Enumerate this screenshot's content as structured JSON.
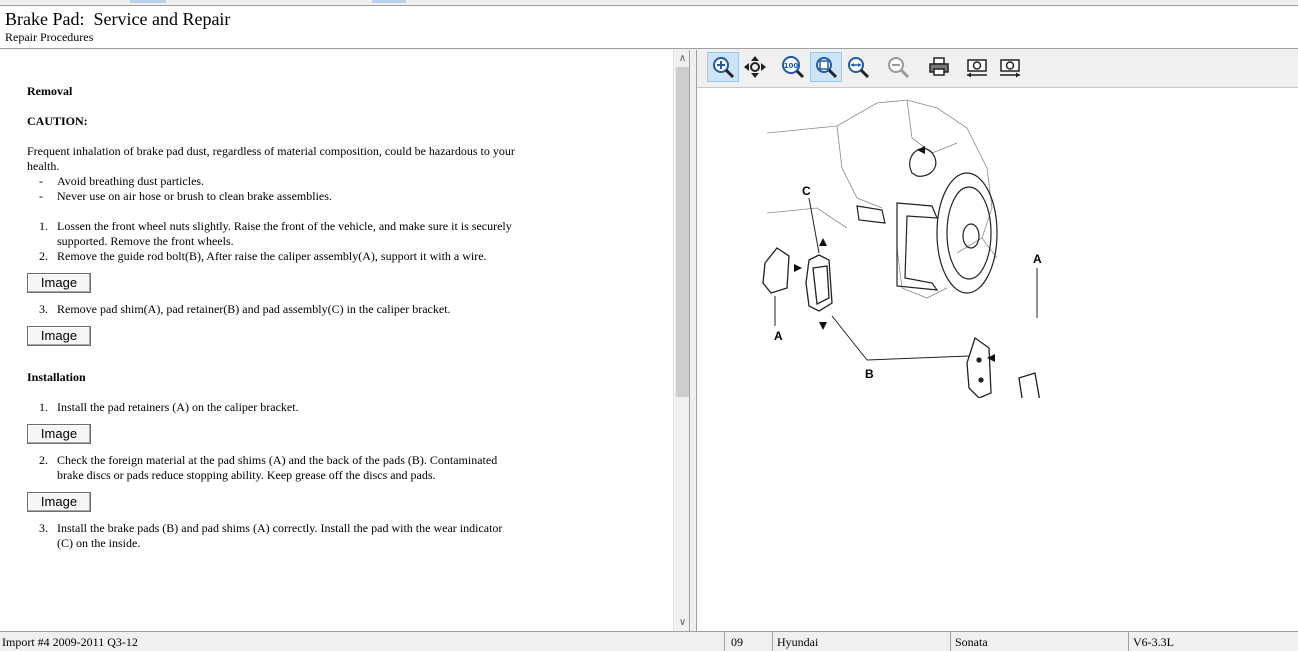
{
  "header": {
    "title": "Brake Pad:  Service and Repair",
    "subtitle": "Repair Procedures"
  },
  "document": {
    "removal_heading": "Removal",
    "caution_heading": "CAUTION:",
    "caution_text": "Frequent inhalation of brake pad dust, regardless of material composition, could be hazardous to your health.",
    "caution_items": [
      "Avoid breathing dust particles.",
      "Never use on air hose or brush to clean brake assemblies."
    ],
    "dash_marker": "-",
    "removal_steps": [
      {
        "num": "1.",
        "text": "Lossen the front wheel nuts slightly. Raise the front of the vehicle, and make sure it is securely supported. Remove the front wheels."
      },
      {
        "num": "2.",
        "text": "Remove the guide rod bolt(B), After raise the caliper assembly(A), support it with a wire."
      },
      {
        "num": "3.",
        "text": "Remove pad shim(A), pad retainer(B) and pad assembly(C) in the caliper bracket."
      }
    ],
    "installation_heading": "Installation",
    "installation_steps": [
      {
        "num": "1.",
        "text": "Install the pad retainers (A) on the caliper bracket."
      },
      {
        "num": "2.",
        "text": "Check the foreign material at the pad shims (A) and the back of the pads (B). Contaminated brake discs or pads reduce stopping ability. Keep grease off the discs and pads."
      },
      {
        "num": "3.",
        "text": "Install the brake pads (B) and pad shims (A) correctly. Install the pad with the wear indicator (C) on the inside."
      }
    ],
    "image_button_label": "Image"
  },
  "scrollbar": {
    "up_glyph": "∧",
    "down_glyph": "∨"
  },
  "toolbar": {
    "tools": [
      {
        "name": "zoom-in-tool",
        "icon": "zoom-in-icon",
        "active": true
      },
      {
        "name": "pan-tool",
        "icon": "pan-move-icon",
        "active": false
      },
      {
        "name": "zoom-100-tool",
        "icon": "zoom-100-icon",
        "active": false
      },
      {
        "name": "zoom-fit-tool",
        "icon": "zoom-fit-icon",
        "active": true
      },
      {
        "name": "zoom-width-tool",
        "icon": "zoom-width-icon",
        "active": false
      },
      {
        "name": "zoom-out-tool",
        "icon": "zoom-out-icon",
        "active": false
      },
      {
        "name": "print-tool",
        "icon": "printer-icon",
        "active": false
      },
      {
        "name": "previous-image-tool",
        "icon": "camera-previous-icon",
        "active": false
      },
      {
        "name": "next-image-tool",
        "icon": "camera-next-icon",
        "active": false
      }
    ]
  },
  "diagram": {
    "labels": {
      "a_left": "A",
      "b": "B",
      "c": "C",
      "a_right": "A"
    }
  },
  "statusbar": {
    "source": "Import #4 2009-2011 Q3-12",
    "year": "09",
    "make": "Hyundai",
    "model": "Sonata",
    "engine": "V6-3.3L"
  },
  "colors": {
    "active_tool_bg": "#cce4f7",
    "chrome_bg": "#f0f0f0",
    "zoom_icon_blue": "#1e5aa8"
  }
}
